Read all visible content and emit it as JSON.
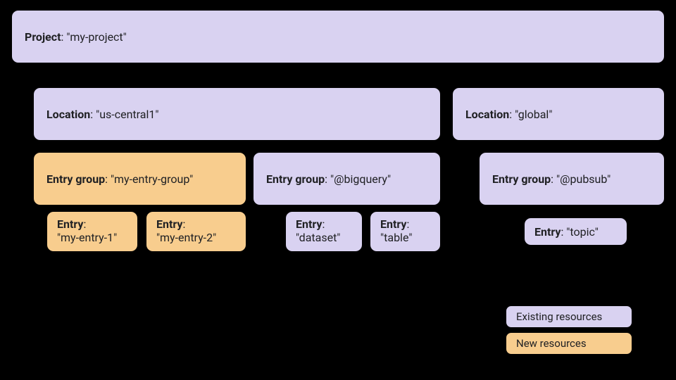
{
  "project": {
    "label": "Project",
    "value": "\"my-project\""
  },
  "locations": [
    {
      "label": "Location",
      "value": "\"us-central1\""
    },
    {
      "label": "Location",
      "value": "\"global\""
    }
  ],
  "entry_groups": [
    {
      "label": "Entry group",
      "value": "\"my-entry-group\""
    },
    {
      "label": "Entry group",
      "value": "\"@bigquery\""
    },
    {
      "label": "Entry group",
      "value": "\"@pubsub\""
    }
  ],
  "entries": [
    {
      "label": "Entry",
      "value": "\"my-entry-1\""
    },
    {
      "label": "Entry",
      "value": "\"my-entry-2\""
    },
    {
      "label": "Entry",
      "value": "\"dataset\""
    },
    {
      "label": "Entry",
      "value": "\"table\""
    },
    {
      "label": "Entry",
      "value": "\"topic\""
    }
  ],
  "legend": {
    "existing": "Existing resources",
    "new": "New resources"
  }
}
